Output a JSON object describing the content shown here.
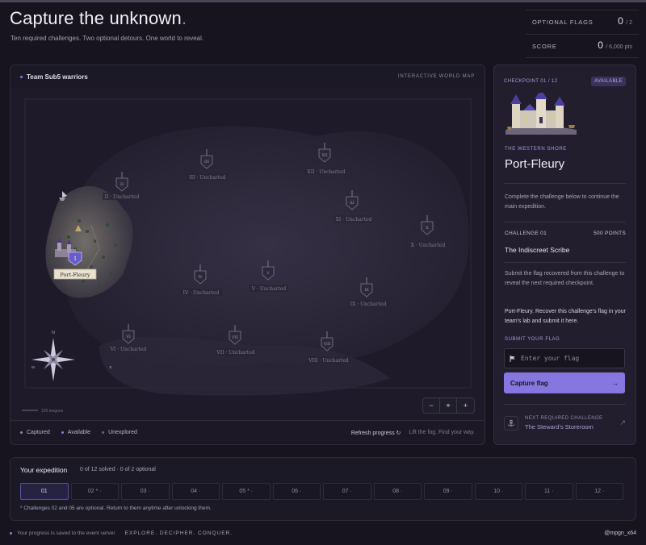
{
  "header": {
    "title": "Capture the unknown",
    "title_dot": ".",
    "subtitle": "Ten required challenges. Two optional detours. One world to reveal."
  },
  "stats": {
    "optional_flags_label": "OPTIONAL FLAGS",
    "optional_flags_value": "0",
    "optional_flags_total": "/ 2",
    "score_label": "SCORE",
    "score_value": "0",
    "score_total": "/ 6,000 pts"
  },
  "map": {
    "team_name": "Team Sub5 warriors",
    "tag": "INTERACTIVE WORLD MAP",
    "scale_label": "100 leagues",
    "compass": {
      "n": "N",
      "w": "W",
      "e": "E"
    },
    "checkpoints": [
      {
        "numeral": "I",
        "label": "Port-Fleury",
        "state": "available"
      },
      {
        "numeral": "II",
        "label": "II · Uncharted",
        "state": "unexplored"
      },
      {
        "numeral": "III",
        "label": "III · Uncharted",
        "state": "unexplored"
      },
      {
        "numeral": "IV",
        "label": "IV · Uncharted",
        "state": "unexplored"
      },
      {
        "numeral": "V",
        "label": "V · Uncharted",
        "state": "unexplored"
      },
      {
        "numeral": "VI",
        "label": "VI · Uncharted",
        "state": "unexplored"
      },
      {
        "numeral": "VII",
        "label": "VII · Uncharted",
        "state": "unexplored"
      },
      {
        "numeral": "VIII",
        "label": "VIII · Uncharted",
        "state": "unexplored"
      },
      {
        "numeral": "IX",
        "label": "IX · Uncharted",
        "state": "unexplored"
      },
      {
        "numeral": "X",
        "label": "X · Uncharted",
        "state": "unexplored"
      },
      {
        "numeral": "XI",
        "label": "XI · Uncharted",
        "state": "unexplored"
      },
      {
        "numeral": "XII",
        "label": "XII · Uncharted",
        "state": "unexplored"
      }
    ],
    "zoom": {
      "out": "−",
      "center": "⌖",
      "in": "+"
    },
    "legend": [
      {
        "label": "Captured",
        "color": "#8f8a9f"
      },
      {
        "label": "Available",
        "color": "#8b7be8"
      },
      {
        "label": "Unexplored",
        "color": "#4a4658"
      }
    ],
    "refresh_label": "Refresh progress ↻",
    "hint": "Lift the fog. Find your way."
  },
  "sidebar": {
    "checkpoint_label": "CHECKPOINT 01 / 12",
    "badge": "AVAILABLE",
    "region": "THE WESTERN SHORE",
    "place": "Port-Fleury",
    "description": "Complete the challenge below to continue the main expedition.",
    "challenge_label": "CHALLENGE 01",
    "points": "500 POINTS",
    "challenge_name": "The Indiscreet Scribe",
    "challenge_desc": "Submit the flag recovered from this challenge to reveal the next required checkpoint.",
    "challenge_note": "Port-Fleury. Recover this challenge's flag in your team's lab and submit it here.",
    "submit_label": "SUBMIT YOUR FLAG",
    "flag_placeholder": "Enter your flag",
    "capture_label": "Capture flag",
    "capture_arrow": "→",
    "next_label": "NEXT REQUIRED CHALLENGE",
    "next_name": "The Steward's Storeroom",
    "next_arrow": "↗"
  },
  "expedition": {
    "title": "Your expedition",
    "meta": "0 of 12 solved · 0 of 2 optional",
    "steps": [
      "01",
      "02 * ·",
      "03 ·",
      "04 ·",
      "05 * ·",
      "06 ·",
      "07 ·",
      "08 ·",
      "09 ·",
      "10 ·",
      "11 ·",
      "12 ·"
    ],
    "note": "* Challenges 02 and 05 are optional. Return to them anytime after unlocking them."
  },
  "footer": {
    "saved": "Your progress is saved to the event server",
    "tagline": "EXPLORE. DECIPHER. CONQUER.",
    "handle": "@mpgn_x64"
  },
  "colors": {
    "accent": "#8b7be8",
    "button": "#8677e0",
    "background": "#17141f"
  }
}
